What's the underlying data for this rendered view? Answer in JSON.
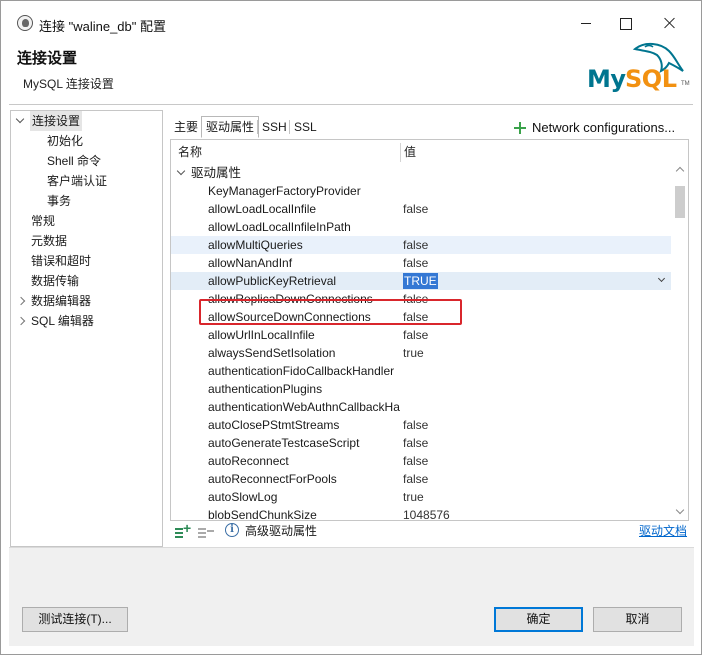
{
  "window": {
    "title": "连接 \"waline_db\" 配置"
  },
  "header": {
    "title": "连接设置",
    "subtitle": "MySQL 连接设置",
    "logo_my": "My",
    "logo_sql": "SQL",
    "logo_tm": "TM"
  },
  "nav": {
    "items": [
      {
        "label": "连接设置",
        "level": 0,
        "expand": "expanded",
        "selected": true
      },
      {
        "label": "初始化",
        "level": 1
      },
      {
        "label": "Shell 命令",
        "level": 1
      },
      {
        "label": "客户端认证",
        "level": 1
      },
      {
        "label": "事务",
        "level": 1
      },
      {
        "label": "常规",
        "level": 0
      },
      {
        "label": "元数据",
        "level": 0
      },
      {
        "label": "错误和超时",
        "level": 0
      },
      {
        "label": "数据传输",
        "level": 0
      },
      {
        "label": "数据编辑器",
        "level": 0,
        "expand": "collapsed"
      },
      {
        "label": "SQL 编辑器",
        "level": 0,
        "expand": "collapsed"
      }
    ]
  },
  "tabs": {
    "items": [
      "主要",
      "驱动属性",
      "SSH",
      "SSL"
    ],
    "active_index": 1
  },
  "toolbar": {
    "network_config": "Network configurations..."
  },
  "table": {
    "col_name": "名称",
    "col_value": "值",
    "category": "驱动属性",
    "rows": [
      {
        "name": "KeyManagerFactoryProvider",
        "value": ""
      },
      {
        "name": "allowLoadLocalInfile",
        "value": "false"
      },
      {
        "name": "allowLoadLocalInfileInPath",
        "value": ""
      },
      {
        "name": "allowMultiQueries",
        "value": "false"
      },
      {
        "name": "allowNanAndInf",
        "value": "false"
      },
      {
        "name": "allowPublicKeyRetrieval",
        "value": "TRUE"
      },
      {
        "name": "allowReplicaDownConnections",
        "value": "false"
      },
      {
        "name": "allowSourceDownConnections",
        "value": "false"
      },
      {
        "name": "allowUrlInLocalInfile",
        "value": "false"
      },
      {
        "name": "alwaysSendSetIsolation",
        "value": "true"
      },
      {
        "name": "authenticationFidoCallbackHandler",
        "value": ""
      },
      {
        "name": "authenticationPlugins",
        "value": ""
      },
      {
        "name": "authenticationWebAuthnCallbackHandler",
        "value": ""
      },
      {
        "name": "autoClosePStmtStreams",
        "value": "false"
      },
      {
        "name": "autoGenerateTestcaseScript",
        "value": "false"
      },
      {
        "name": "autoReconnect",
        "value": "false"
      },
      {
        "name": "autoReconnectForPools",
        "value": "false"
      },
      {
        "name": "autoSlowLog",
        "value": "true"
      },
      {
        "name": "blobSendChunkSize",
        "value": "1048576"
      }
    ],
    "highlighted_row": 3,
    "editing_row": 5
  },
  "bottom": {
    "advanced_label": "高级驱动属性",
    "driver_doc": "驱动文档"
  },
  "footer": {
    "test_button": "测试连接(T)...",
    "ok_button": "确定",
    "cancel_button": "取消"
  },
  "colors": {
    "mysql_blue": "#00758f",
    "mysql_orange": "#f29111",
    "selection_blue": "#3478d4",
    "highlight_red": "#d9262c",
    "link_blue": "#0066cc",
    "add_green": "#3aa24a"
  }
}
